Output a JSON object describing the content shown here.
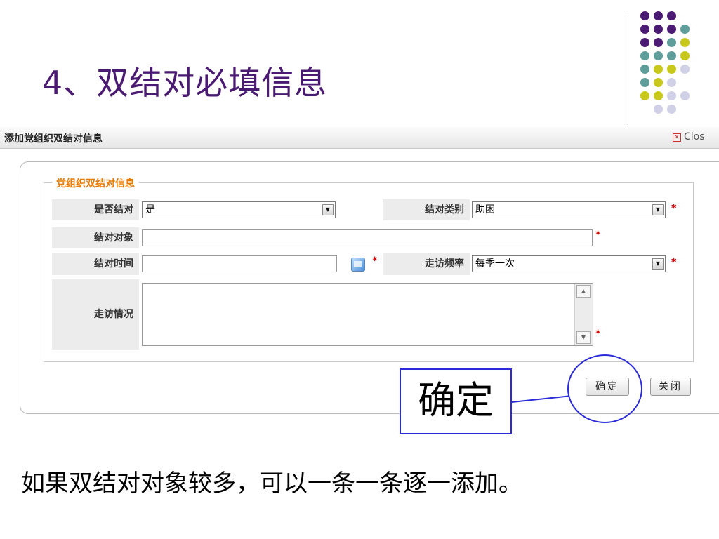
{
  "slide": {
    "title": "4、双结对必填信息",
    "bottom_note": "如果双结对对象较多，可以一条一条逐一添加。",
    "callout_text": "确定",
    "colors": {
      "title": "#4b1a72",
      "callout": "#2b2bd9",
      "legend": "#e87a00",
      "required": "#d40000"
    }
  },
  "dialog": {
    "title": "添加党组织双结对信息",
    "close_label": "Clos",
    "legend": "党组织双结对信息",
    "fields": {
      "is_pair_label": "是否结对",
      "is_pair_value": "是",
      "pair_type_label": "结对类别",
      "pair_type_value": "助困",
      "pair_target_label": "结对对象",
      "pair_time_label": "结对时间",
      "visit_freq_label": "走访频率",
      "visit_freq_value": "每季一次",
      "visit_status_label": "走访情况"
    },
    "required_mark": "*",
    "buttons": {
      "confirm": "确定",
      "close": "关闭"
    }
  }
}
